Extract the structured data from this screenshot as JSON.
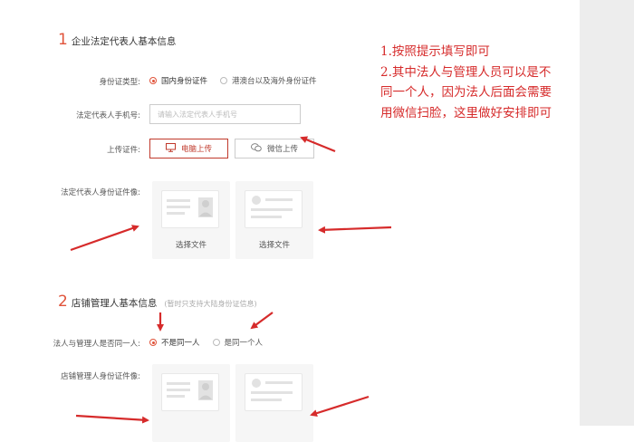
{
  "section1": {
    "number": "1",
    "title": "企业法定代表人基本信息",
    "id_type": {
      "label": "身份证类型:",
      "options": [
        {
          "text": "国内身份证件",
          "checked": true
        },
        {
          "text": "港澳台以及海外身份证件",
          "checked": false
        }
      ]
    },
    "phone": {
      "label": "法定代表人手机号:",
      "placeholder": "请输入法定代表人手机号"
    },
    "upload": {
      "label": "上传证件:",
      "pc_button": "电脑上传",
      "wechat_button": "微信上传"
    },
    "id_photo": {
      "label": "法定代表人身份证件像:",
      "front_caption": "选择文件",
      "back_caption": "选择文件"
    }
  },
  "section2": {
    "number": "2",
    "title": "店铺管理人基本信息",
    "note": "(暂时只支持大陆身份证信息)",
    "same_person": {
      "label": "法人与管理人是否同一人:",
      "options": [
        {
          "text": "不是同一人",
          "checked": true
        },
        {
          "text": "是同一个人",
          "checked": false
        }
      ]
    },
    "id_photo": {
      "label": "店铺管理人身份证件像:"
    }
  },
  "annotation": {
    "lines": [
      "1.按照提示填写即可",
      "2.其中法人与管理人员可以是不",
      "同一个人，因为法人后面会需要",
      "用微信扫脸，这里做好安排即可"
    ]
  },
  "colors": {
    "accent": "#e0533a",
    "annotation_red": "#d62b2b",
    "button_red": "#c0392b"
  },
  "icons": [
    "monitor-icon",
    "wechat-icon",
    "id-card-front-icon",
    "id-card-back-icon",
    "arrow-icon"
  ]
}
